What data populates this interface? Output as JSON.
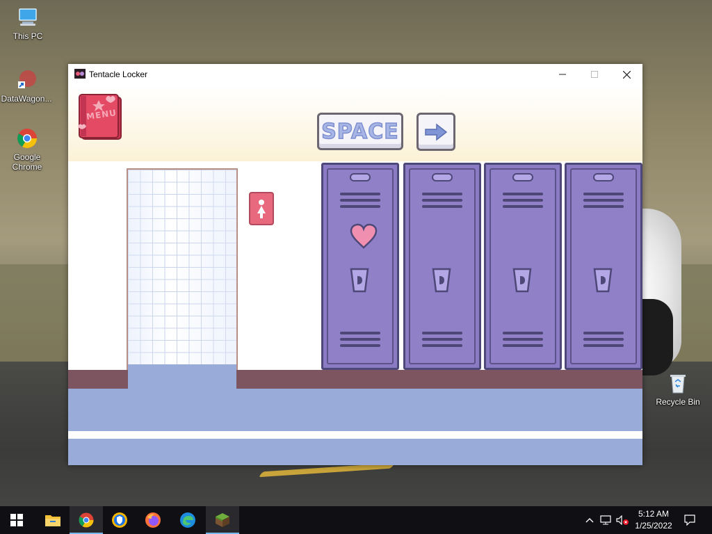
{
  "desktop": {
    "icons": [
      {
        "label": "This PC",
        "icon": "this-pc-icon"
      },
      {
        "label": "DataWagon...",
        "icon": "datawagon-shortcut-icon"
      },
      {
        "label": "Google Chrome",
        "icon": "chrome-icon"
      },
      {
        "label": "Recycle Bin",
        "icon": "recycle-bin-icon"
      }
    ]
  },
  "window": {
    "title": "Tentacle Locker",
    "controls": [
      "minimize",
      "maximize",
      "close"
    ]
  },
  "game": {
    "menu_label": "MENU",
    "space_label": "SPACE",
    "next_arrow": "arrow-right-icon",
    "locker_count": 4,
    "heart_on_locker": 1
  },
  "taskbar": {
    "apps": [
      {
        "name": "start",
        "icon": "windows-logo-icon"
      },
      {
        "name": "file-explorer",
        "icon": "folder-icon"
      },
      {
        "name": "chrome",
        "icon": "chrome-icon",
        "active": true
      },
      {
        "name": "brave",
        "icon": "shield-browser-icon"
      },
      {
        "name": "firefox",
        "icon": "firefox-icon"
      },
      {
        "name": "edge",
        "icon": "edge-icon"
      },
      {
        "name": "minecraft",
        "icon": "grass-block-icon",
        "active": true
      }
    ],
    "time": "5:12 AM",
    "date": "1/25/2022"
  }
}
